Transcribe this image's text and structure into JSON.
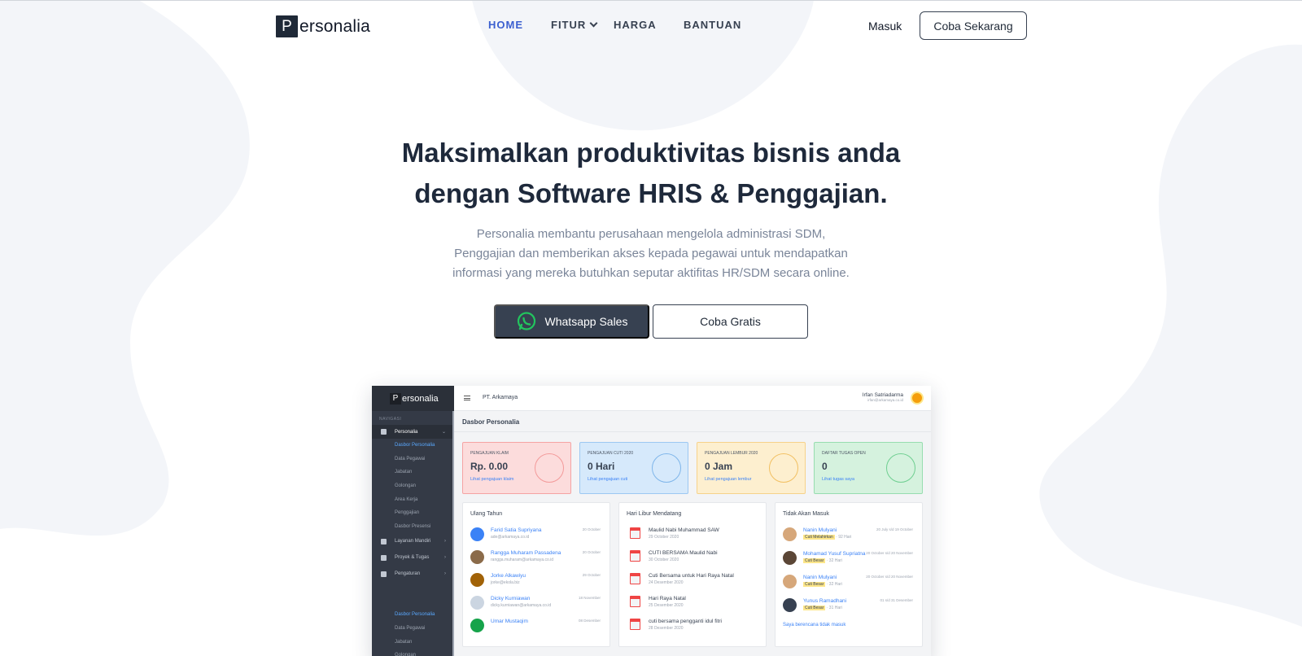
{
  "header": {
    "logo_letter": "P",
    "logo_rest": "ersonalia",
    "nav": [
      {
        "label": "HOME",
        "active": true
      },
      {
        "label": "FITUR",
        "has_dropdown": true
      },
      {
        "label": "HARGA"
      },
      {
        "label": "BANTUAN"
      }
    ],
    "login_label": "Masuk",
    "cta_label": "Coba Sekarang"
  },
  "hero": {
    "title_lines": [
      "Maksimalkan produktivitas bisnis anda",
      "dengan Software HRIS & Penggajian."
    ],
    "subtitle_lines": [
      "Personalia membantu perusahaan mengelola administrasi SDM,",
      "Penggajian dan memberikan akses kepada pegawai untuk mendapatkan",
      "informasi yang mereka butuhkan seputar aktifitas HR/SDM secara online."
    ],
    "whatsapp_label": "Whatsapp Sales",
    "trial_label": "Coba Gratis"
  },
  "preview": {
    "logo_letter": "P",
    "logo_rest": "ersonalia",
    "nav_header": "NAVIGASI",
    "menu_personalia": "Personalia",
    "submenu": [
      "Dasbor Personalia",
      "Data Pegawai",
      "Jabatan",
      "Golongan",
      "Area Kerja",
      "Penggajian",
      "Dasbor Presensi"
    ],
    "menu_others": [
      "Layanan Mandiri",
      "Proyek & Tugas",
      "Pengaturan"
    ],
    "submenu2": [
      "Dasbor Personalia",
      "Data Pegawai",
      "Jabatan",
      "Golongan"
    ],
    "company": "PT. Arkamaya",
    "user_name": "Irfan Satriadarma",
    "user_email": "irfan@arkamaya.co.id",
    "page_title": "Dasbor Personalia",
    "cards": [
      {
        "label": "PENGAJUAN KLAIM",
        "value": "Rp. 0.00",
        "link": "Lihat pengajuan klaim",
        "bg": "#fcdcdc",
        "border": "#f5a3a3",
        "icon": "wallet-icon"
      },
      {
        "label": "PENGAJUAN CUTI 2020",
        "value": "0 Hari",
        "link": "Lihat pengajuan cuti",
        "bg": "#d6e9fb",
        "border": "#9cc8f2",
        "icon": "plane-icon"
      },
      {
        "label": "PENGAJUAN LEMBUR 2020",
        "value": "0 Jam",
        "link": "Lihat pengajuan lembur",
        "bg": "#fdefcf",
        "border": "#f6d28a",
        "icon": "clock-icon"
      },
      {
        "label": "DAFTAR TUGAS OPEN",
        "value": "0",
        "link": "Lihat tugas saya",
        "bg": "#d5f2de",
        "border": "#97ddb0",
        "icon": "calendar-check-icon"
      }
    ],
    "birthdays_title": "Ulang Tahun",
    "birthdays": [
      {
        "name": "Farid Satia Supriyana",
        "email": "ade@arkamaya.co.id",
        "date": "20 October"
      },
      {
        "name": "Rangga Muharam Passadena",
        "email": "rangga.muharam@arkamaya.co.id",
        "date": "20 October"
      },
      {
        "name": "Jorke Alkawiyu",
        "email": "jorke@ekola.biz",
        "date": "29 October"
      },
      {
        "name": "Dicky Kurniawan",
        "email": "dicky.kurniawan@arkamaya.co.id",
        "date": "18 November"
      },
      {
        "name": "Umar Mustaqim",
        "email": "",
        "date": "08 Desember"
      }
    ],
    "holidays_title": "Hari Libur Mendatang",
    "holidays": [
      {
        "name": "Maulid Nabi Muhammad SAW",
        "date": "29 October 2020"
      },
      {
        "name": "CUTI BERSAMA Maulid Nabi",
        "date": "30 October 2020"
      },
      {
        "name": "Cuti Bersama untuk Hari Raya Natal",
        "date": "24 Desember 2020"
      },
      {
        "name": "Hari Raya Natal",
        "date": "25 Desember 2020"
      },
      {
        "name": "cuti bersama pengganti idul fitri",
        "date": "28 Desember 2020"
      }
    ],
    "absent_title": "Tidak Akan Masuk",
    "absent": [
      {
        "name": "Nanin Mulyani",
        "badge": "Cuti Melahirkan",
        "tail": "· 92 Hari",
        "date": "20 July s/d 19 October"
      },
      {
        "name": "Mohamad Yusuf Supriatna",
        "badge": "Cuti Besar",
        "tail": "· 32 Hari",
        "date": "20 October s/d 20 November"
      },
      {
        "name": "Nanin Mulyani",
        "badge": "Cuti Besar",
        "tail": "· 32 Hari",
        "date": "20 October s/d 20 November"
      },
      {
        "name": "Yunus Ramadhani",
        "badge": "Cuti Besar",
        "tail": "· 31 Hari",
        "date": "01 s/d 31 Desember"
      }
    ],
    "absent_link": "Saya berencana tidak masuk"
  }
}
